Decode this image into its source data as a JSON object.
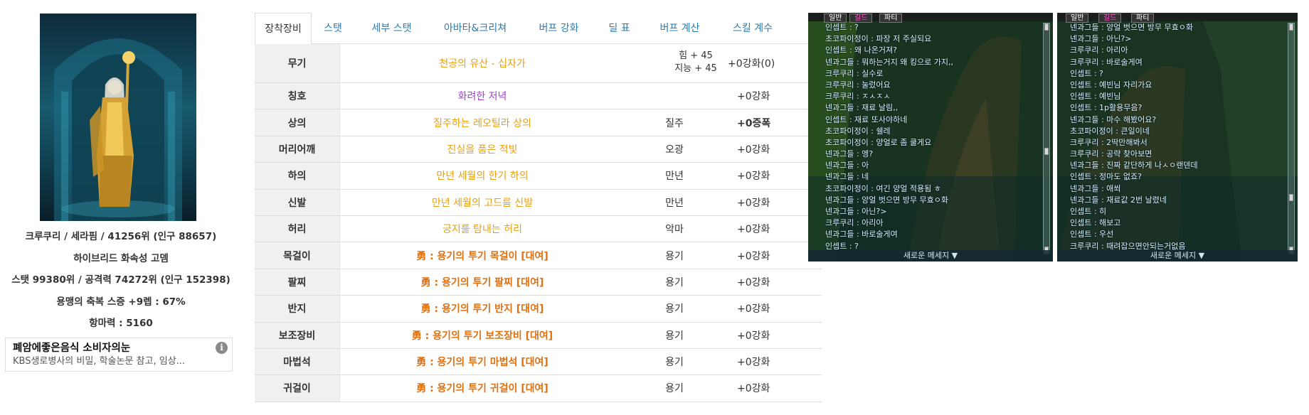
{
  "character": {
    "name_line": "크루쿠리 / 세라핌 / 41256위 (인구 88657)",
    "guild_line": "하이브리드 화속성 고뎀",
    "rank_line": "스탯 99380위 / 공격력 74272위 (인구 152398)",
    "buff_line": "용맹의 축복 스증 +9렙 : 67%",
    "resist_line": "항마력 : 5160"
  },
  "ad": {
    "title": "폐암에좋은음식 소비자의눈",
    "desc": "KBS생로병사의 비밀, 학술논문 참고, 임상...",
    "info": "i"
  },
  "tabs": [
    "장착장비",
    "스탯",
    "세부 스탯",
    "아바타&크리쳐",
    "버프 강화",
    "딜 표",
    "버프 계산",
    "스킬 계수"
  ],
  "equipment": [
    {
      "slot": "무기",
      "item": "천공의 유산 - 십자가",
      "color": "#e8a010",
      "stat1": "힘 + 45",
      "stat2": "지능 + 45",
      "set": "",
      "enh": "+0강화(0)"
    },
    {
      "slot": "칭호",
      "item": "화려한 저녁",
      "color": "#a040d0",
      "set": "",
      "enh": "+0강화"
    },
    {
      "slot": "상의",
      "item": "질주하는 레오틸라 상의",
      "color": "#e8a010",
      "set": "질주",
      "enh": "+0증폭"
    },
    {
      "slot": "머리어깨",
      "item": "진실을 품은 적빛",
      "color": "#e8a010",
      "set": "오광",
      "enh": "+0강화"
    },
    {
      "slot": "하의",
      "item": "만년 세월의 한기 하의",
      "color": "#e8a010",
      "set": "만년",
      "enh": "+0강화"
    },
    {
      "slot": "신발",
      "item": "만년 세월의 고드름 신발",
      "color": "#e8a010",
      "set": "만년",
      "enh": "+0강화"
    },
    {
      "slot": "허리",
      "item": "긍지를 탐내는 허리",
      "color": "#e8a010",
      "set": "악마",
      "enh": "+0강화"
    },
    {
      "slot": "목걸이",
      "item": "勇 : 용기의 투기 목걸이 [대여]",
      "color": "#e07010",
      "set": "용기",
      "enh": "+0강화"
    },
    {
      "slot": "팔찌",
      "item": "勇 : 용기의 투기 팔찌 [대여]",
      "color": "#e07010",
      "set": "용기",
      "enh": "+0강화"
    },
    {
      "slot": "반지",
      "item": "勇 : 용기의 투기 반지 [대여]",
      "color": "#e07010",
      "set": "용기",
      "enh": "+0강화"
    },
    {
      "slot": "보조장비",
      "item": "勇 : 용기의 투기 보조장비 [대여]",
      "color": "#e07010",
      "set": "용기",
      "enh": "+0강화"
    },
    {
      "slot": "마법석",
      "item": "勇 : 용기의 투기 마법석 [대여]",
      "color": "#e07010",
      "set": "용기",
      "enh": "+0강화"
    },
    {
      "slot": "귀걸이",
      "item": "勇 : 용기의 투기 귀걸이 [대여]",
      "color": "#e07010",
      "set": "용기",
      "enh": "+0강화"
    }
  ],
  "chat_left": {
    "buttons": [
      "일반",
      "길드",
      "파티"
    ],
    "lines": [
      "인셉트 : ?",
      "초코파이정이 : 파장 저 주실되요",
      "인셉트 : 왜 나온거져?",
      "넨과그들 : 뭐하는거지 왜 킹으로 가지,,",
      "크루쿠리 : 실수로",
      "크루쿠리 : 눌렀어요",
      "크루쿠리 : ㅈㅅㅈㅅ",
      "넨과그들 : 재료 날림,,",
      "인셉트 : 재료 또사야하네",
      "초코파이정이 : 쉘레",
      "초코파이정이 : 양얼로 좀 쿨게요",
      "넨과그들 : 엥?",
      "넨과그들 : 아",
      "넨과그들 : 네",
      "초코파이정이 : 여긴 양얼 적용됨 ㅎ",
      "넨과그들 : 양얼 벗으면 방무 무효ㅇ화",
      "넨과그들 : 아닌?>",
      "크루쿠리 : 아리아",
      "넨과그들 : 바로술게여",
      "인셉트 : ?"
    ],
    "new_message": "새로운 메세지 ▼"
  },
  "chat_right": {
    "buttons": [
      "일반",
      "길드",
      "파티"
    ],
    "lines": [
      "넨과그들 : 양얼 벗으면 방무 무효ㅇ화",
      "넨과그들 : 아닌?>",
      "크루쿠리 : 아리아",
      "크루쿠리 : 바로술게여",
      "인셉트 : ?",
      "인셉트 : 예빈님 자리가요",
      "인셉트 : 예빈님",
      "인셉트 : 1p활용무음?",
      "넨과그들 : 마수 해봤어요?",
      "초코파이정이 : 큰일이네",
      "크루쿠리 : 2딱만해봐서",
      "크루쿠리 : 공략 찾아보면",
      "넨과그들 : 진짜 같단하게 나ㅅㅇ랜덴데",
      "인셉트 : 정마도 없죠?",
      "넨과그들 : 애쐬",
      "넨과그들 : 재료값 2번 날렸네",
      "인셉트 : 히",
      "인셉트 : 해보고",
      "인셉트 : 우선",
      "크루쿠리 : 때려잡으면안되는거없음"
    ],
    "new_message": "새로운 메세지 ▼"
  }
}
